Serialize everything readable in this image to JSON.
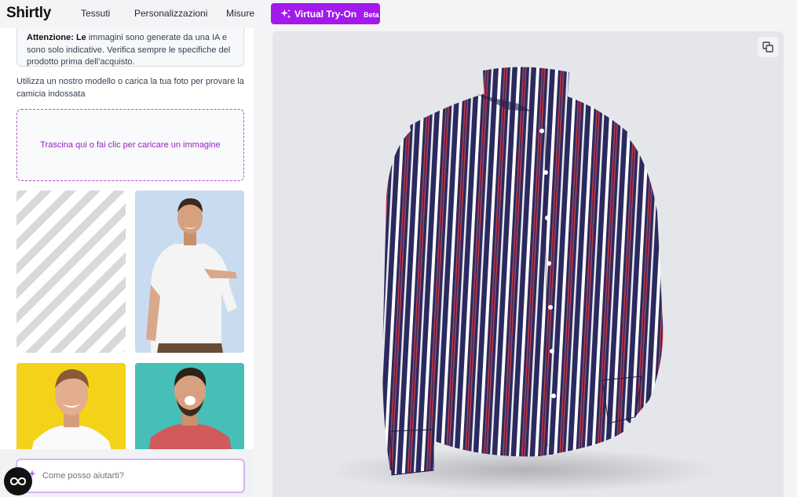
{
  "header": {
    "logo": "Shirtly",
    "nav": [
      "Tessuti",
      "Personalizzazioni",
      "Misure"
    ],
    "cta_label": "Virtual Try-On",
    "cta_badge": "Beta",
    "accent_color": "#a21aec"
  },
  "sidebar": {
    "notice_hidden_heading": "Attenzione: Le",
    "notice_text": "sono solo indicative. Verifica sempre le specifiche del prodotto prima dell’acquisto.",
    "notice_first_line_tail": "immagini sono generate da una IA e",
    "intro": "Utilizza un nostro modello o carica la tua foto per provare la camicia indossata",
    "dropzone_text": "Trascina qui o fai clic per caricare un immagine",
    "models": [
      {
        "name": "placeholder",
        "shirt": "none"
      },
      {
        "name": "model-glasses",
        "shirt": "white t-shirt",
        "bg": "#c9dcef"
      },
      {
        "name": "model-yellow",
        "shirt": "white t-shirt",
        "bg": "#f4d21a"
      },
      {
        "name": "model-teal",
        "shirt": "red t-shirt",
        "bg": "#45bfb8"
      }
    ]
  },
  "chat": {
    "placeholder": "Come posso aiutarti?"
  },
  "viewer": {
    "product": "striped shirt",
    "shirt_base_color": "#2b2a5e",
    "stripe_colors": [
      "#ffffff",
      "#c0394a"
    ]
  }
}
